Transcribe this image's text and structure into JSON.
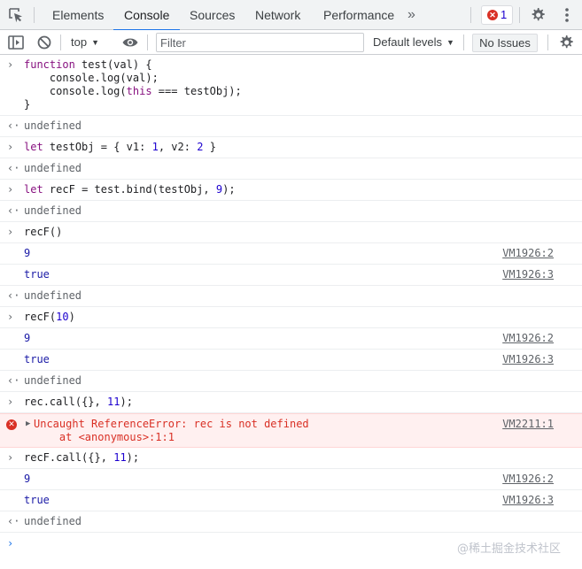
{
  "tabbar": {
    "tabs": [
      {
        "label": "Elements"
      },
      {
        "label": "Console",
        "active": true
      },
      {
        "label": "Sources"
      },
      {
        "label": "Network"
      },
      {
        "label": "Performance"
      }
    ],
    "more_label": "»",
    "error_count": "1",
    "icons": [
      "inspect-icon",
      "gear-icon",
      "kebab-menu-icon"
    ]
  },
  "toolbar": {
    "context": "top",
    "filter_placeholder": "Filter",
    "levels_label": "Default levels",
    "issues_label": "No Issues",
    "icons": [
      "sidebar-toggle-icon",
      "clear-console-icon",
      "eye-icon",
      "gear-icon",
      "dropdown-caret-icon"
    ]
  },
  "console": {
    "entries": [
      {
        "kind": "input",
        "lines": [
          "function test(val) {",
          "    console.log(val);",
          "    console.log(this === testObj);",
          "}"
        ]
      },
      {
        "kind": "result",
        "text": "undefined"
      },
      {
        "kind": "input",
        "lines": [
          "let testObj = { v1: 1, v2: 2 }"
        ]
      },
      {
        "kind": "result",
        "text": "undefined"
      },
      {
        "kind": "input",
        "lines": [
          "let recF = test.bind(testObj, 9);"
        ]
      },
      {
        "kind": "result",
        "text": "undefined"
      },
      {
        "kind": "input",
        "lines": [
          "recF()"
        ]
      },
      {
        "kind": "log",
        "text": "9",
        "source": "VM1926:2"
      },
      {
        "kind": "log",
        "text": "true",
        "source": "VM1926:3"
      },
      {
        "kind": "result",
        "text": "undefined"
      },
      {
        "kind": "input",
        "lines": [
          "recF(10)"
        ]
      },
      {
        "kind": "log",
        "text": "9",
        "source": "VM1926:2"
      },
      {
        "kind": "log",
        "text": "true",
        "source": "VM1926:3"
      },
      {
        "kind": "result",
        "text": "undefined"
      },
      {
        "kind": "input",
        "lines": [
          "rec.call({}, 11);"
        ]
      },
      {
        "kind": "error",
        "lines": [
          "Uncaught ReferenceError: rec is not defined",
          "    at <anonymous>:1:1"
        ],
        "source": "VM2211:1"
      },
      {
        "kind": "input",
        "lines": [
          "recF.call({}, 11);"
        ]
      },
      {
        "kind": "log",
        "text": "9",
        "source": "VM1926:2"
      },
      {
        "kind": "log",
        "text": "true",
        "source": "VM1926:3"
      },
      {
        "kind": "result",
        "text": "undefined"
      }
    ],
    "prompt_symbol": "›",
    "result_symbol": "‹·",
    "input_symbol": "›",
    "error_symbol": "✕",
    "expand_symbol": "▶"
  },
  "watermark": "@稀土掘金技术社区",
  "colors": {
    "accent": "#1a73e8",
    "error": "#d93025",
    "error_bg": "#fff0f0",
    "keyword": "#881280",
    "number": "#1c00cf"
  }
}
